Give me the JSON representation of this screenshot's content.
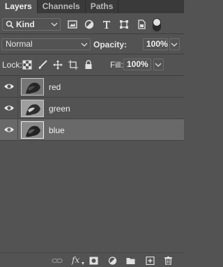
{
  "tabs": [
    {
      "label": "Layers",
      "active": true
    },
    {
      "label": "Channels",
      "active": false
    },
    {
      "label": "Paths",
      "active": false
    }
  ],
  "filter": {
    "kind_label": "Kind",
    "icons": [
      "pixel-filter-icon",
      "adjustment-filter-icon",
      "type-filter-icon",
      "shape-filter-icon",
      "smart-object-filter-icon",
      "filter-toggle"
    ]
  },
  "blend": {
    "mode": "Normal",
    "opacity_label": "Opacity:",
    "opacity_value": "100%"
  },
  "lock": {
    "label": "Lock:",
    "fill_label": "Fill:",
    "fill_value": "100%"
  },
  "layers": [
    {
      "name": "red",
      "visible": true,
      "selected": false
    },
    {
      "name": "green",
      "visible": true,
      "selected": false
    },
    {
      "name": "blue",
      "visible": true,
      "selected": true
    }
  ],
  "colors": {
    "panel_bg": "#535353",
    "tabbar_bg": "#3a3a3a",
    "selected_row": "#696969"
  }
}
